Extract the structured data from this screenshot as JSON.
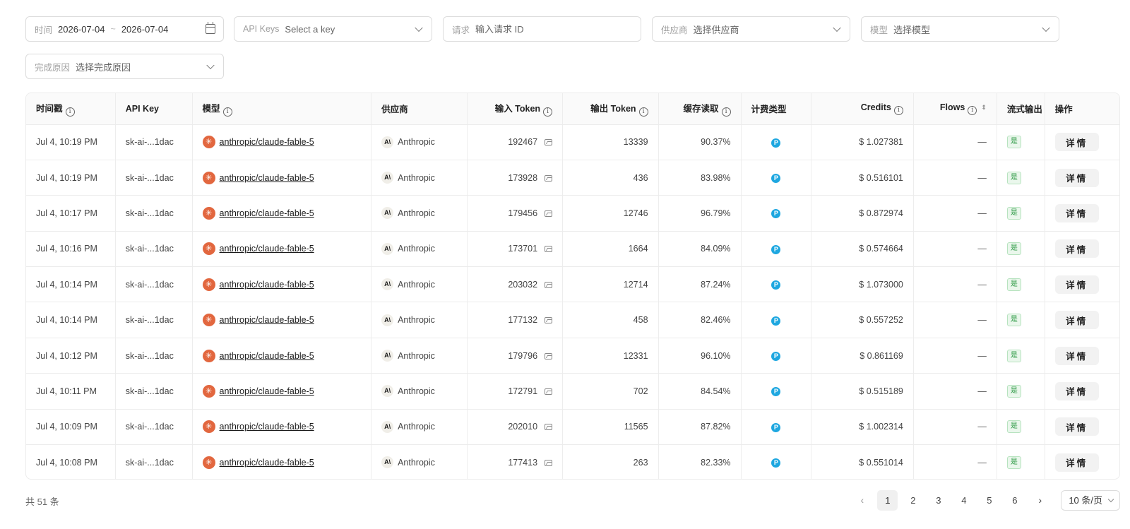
{
  "filters": {
    "time": {
      "label": "时间",
      "start": "2026-07-04",
      "separator": "~",
      "end": "2026-07-04"
    },
    "api_keys": {
      "label": "API Keys",
      "placeholder": "Select a key"
    },
    "request": {
      "label": "请求",
      "placeholder": "输入请求 ID"
    },
    "provider": {
      "label": "供应商",
      "placeholder": "选择供应商"
    },
    "model": {
      "label": "模型",
      "placeholder": "选择模型"
    },
    "finish_reason": {
      "label": "完成原因",
      "placeholder": "选择完成原因"
    }
  },
  "table": {
    "columns": {
      "timestamp": "时间戳",
      "api_key": "API Key",
      "model": "模型",
      "provider": "供应商",
      "input_tokens": "输入 Token",
      "output_tokens": "输出 Token",
      "cache_read": "缓存读取",
      "billing_type": "计费类型",
      "credits": "Credits",
      "flows": "Flows",
      "streaming": "流式输出",
      "actions": "操作"
    },
    "rows": [
      {
        "timestamp": "Jul 4, 10:19 PM",
        "api_key": "sk-ai-...1dac",
        "model": "anthropic/claude-fable-5",
        "provider": "Anthropic",
        "input_tokens": "192467",
        "output_tokens": "13339",
        "cache_read": "90.37%",
        "credits": "$ 1.027381",
        "flows": "—",
        "streaming": "是",
        "action": "详情"
      },
      {
        "timestamp": "Jul 4, 10:19 PM",
        "api_key": "sk-ai-...1dac",
        "model": "anthropic/claude-fable-5",
        "provider": "Anthropic",
        "input_tokens": "173928",
        "output_tokens": "436",
        "cache_read": "83.98%",
        "credits": "$ 0.516101",
        "flows": "—",
        "streaming": "是",
        "action": "详情"
      },
      {
        "timestamp": "Jul 4, 10:17 PM",
        "api_key": "sk-ai-...1dac",
        "model": "anthropic/claude-fable-5",
        "provider": "Anthropic",
        "input_tokens": "179456",
        "output_tokens": "12746",
        "cache_read": "96.79%",
        "credits": "$ 0.872974",
        "flows": "—",
        "streaming": "是",
        "action": "详情"
      },
      {
        "timestamp": "Jul 4, 10:16 PM",
        "api_key": "sk-ai-...1dac",
        "model": "anthropic/claude-fable-5",
        "provider": "Anthropic",
        "input_tokens": "173701",
        "output_tokens": "1664",
        "cache_read": "84.09%",
        "credits": "$ 0.574664",
        "flows": "—",
        "streaming": "是",
        "action": "详情"
      },
      {
        "timestamp": "Jul 4, 10:14 PM",
        "api_key": "sk-ai-...1dac",
        "model": "anthropic/claude-fable-5",
        "provider": "Anthropic",
        "input_tokens": "203032",
        "output_tokens": "12714",
        "cache_read": "87.24%",
        "credits": "$ 1.073000",
        "flows": "—",
        "streaming": "是",
        "action": "详情"
      },
      {
        "timestamp": "Jul 4, 10:14 PM",
        "api_key": "sk-ai-...1dac",
        "model": "anthropic/claude-fable-5",
        "provider": "Anthropic",
        "input_tokens": "177132",
        "output_tokens": "458",
        "cache_read": "82.46%",
        "credits": "$ 0.557252",
        "flows": "—",
        "streaming": "是",
        "action": "详情"
      },
      {
        "timestamp": "Jul 4, 10:12 PM",
        "api_key": "sk-ai-...1dac",
        "model": "anthropic/claude-fable-5",
        "provider": "Anthropic",
        "input_tokens": "179796",
        "output_tokens": "12331",
        "cache_read": "96.10%",
        "credits": "$ 0.861169",
        "flows": "—",
        "streaming": "是",
        "action": "详情"
      },
      {
        "timestamp": "Jul 4, 10:11 PM",
        "api_key": "sk-ai-...1dac",
        "model": "anthropic/claude-fable-5",
        "provider": "Anthropic",
        "input_tokens": "172791",
        "output_tokens": "702",
        "cache_read": "84.54%",
        "credits": "$ 0.515189",
        "flows": "—",
        "streaming": "是",
        "action": "详情"
      },
      {
        "timestamp": "Jul 4, 10:09 PM",
        "api_key": "sk-ai-...1dac",
        "model": "anthropic/claude-fable-5",
        "provider": "Anthropic",
        "input_tokens": "202010",
        "output_tokens": "11565",
        "cache_read": "87.82%",
        "credits": "$ 1.002314",
        "flows": "—",
        "streaming": "是",
        "action": "详情"
      },
      {
        "timestamp": "Jul 4, 10:08 PM",
        "api_key": "sk-ai-...1dac",
        "model": "anthropic/claude-fable-5",
        "provider": "Anthropic",
        "input_tokens": "177413",
        "output_tokens": "263",
        "cache_read": "82.33%",
        "credits": "$ 0.551014",
        "flows": "—",
        "streaming": "是",
        "action": "详情"
      }
    ]
  },
  "icons": {
    "model": "anthropic-sparkle-icon",
    "provider": "anthropic-logo-icon",
    "input_tokens": "image-icon",
    "billing_type": "billing-p-icon",
    "info": "info-icon",
    "sort": "sort-icon"
  },
  "colors": {
    "model_icon": "#e2673f",
    "billing_icon": "#1ea7e0",
    "stream_badge": "#2e9a45"
  },
  "pagination": {
    "total": "共 51 条",
    "pages": [
      "1",
      "2",
      "3",
      "4",
      "5",
      "6"
    ],
    "current": "1",
    "prev": "‹",
    "next": "›",
    "page_size": "10 条/页"
  }
}
